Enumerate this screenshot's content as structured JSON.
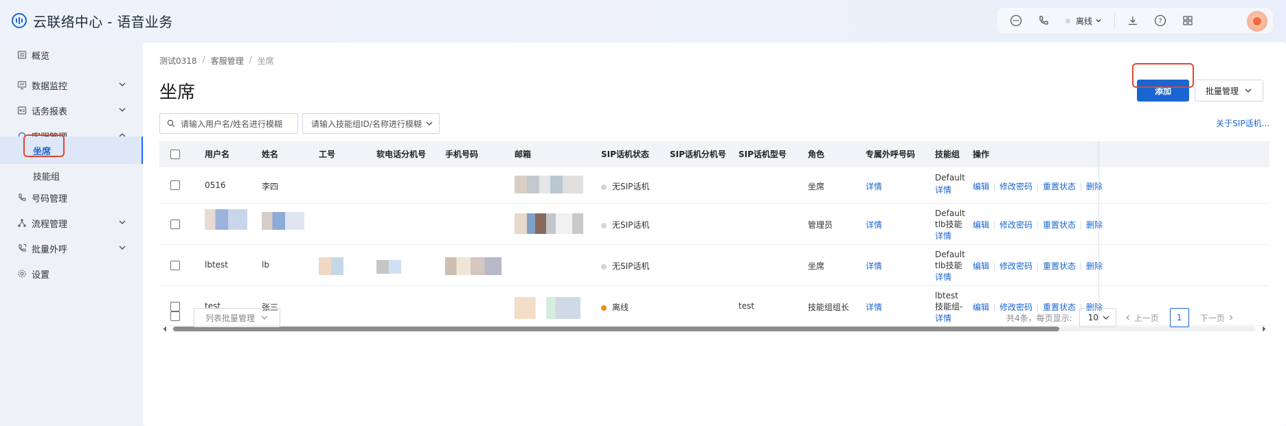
{
  "app": {
    "title": "云联络中心 - 语音业务"
  },
  "top": {
    "status": "离线"
  },
  "sidebar": {
    "items": [
      {
        "label": "概览"
      },
      {
        "label": "数据监控"
      },
      {
        "label": "话务报表"
      },
      {
        "label": "客服管理"
      },
      {
        "label": "坐席"
      },
      {
        "label": "技能组"
      },
      {
        "label": "号码管理"
      },
      {
        "label": "流程管理"
      },
      {
        "label": "批量外呼"
      },
      {
        "label": "设置"
      }
    ]
  },
  "breadcrumb": [
    "测试0318",
    "客服管理",
    "坐席"
  ],
  "page": {
    "title": "坐席"
  },
  "toolbar": {
    "add_label": "添加",
    "batch_label": "批量管理",
    "user_search_placeholder": "请输入用户名/姓名进行模糊",
    "skill_search_placeholder": "请输入技能组ID/名称进行模糊",
    "sip_link": "关于SIP话机..."
  },
  "table": {
    "columns": [
      "用户名",
      "姓名",
      "工号",
      "软电话分机号",
      "手机号码",
      "邮箱",
      "SIP话机状态",
      "SIP话机分机号",
      "SIP话机型号",
      "角色",
      "专属外呼号码",
      "技能组",
      "操作"
    ],
    "rows": [
      {
        "username": "0516",
        "name": "李四",
        "sip_status": "无SIP话机",
        "sip_model": "",
        "role": "坐席",
        "outbound": "详情",
        "skill": "Default",
        "skill_link": "详情"
      },
      {
        "username": "",
        "name": "",
        "sip_status": "无SIP话机",
        "sip_model": "",
        "role": "管理员",
        "outbound": "详情",
        "skill": "Default、tlb技能组",
        "skill_link": "详情"
      },
      {
        "username": "lbtest",
        "name": "lb",
        "sip_status": "无SIP话机",
        "sip_model": "",
        "role": "坐席",
        "outbound": "详情",
        "skill": "Default、tlb技能组",
        "skill_link": "详情"
      },
      {
        "username": "test",
        "name": "张三",
        "sip_status": "离线",
        "sip_model": "test",
        "role": "技能组组长",
        "outbound": "详情",
        "skill": "lbtest技能组-在线、",
        "skill_link": "详情"
      }
    ],
    "ops": [
      "编辑",
      "修改密码",
      "重置状态",
      "删除"
    ]
  },
  "footer": {
    "bulk_label": "列表批量管理",
    "total": "共4条，每页显示:",
    "page_size": "10",
    "prev": "上一页",
    "page": "1",
    "next": "下一页"
  },
  "colors": {
    "primary": "#1966d2",
    "highlight": "#e0452f",
    "offline_dot": "#f08a1c",
    "none_dot": "#cfd5de"
  }
}
